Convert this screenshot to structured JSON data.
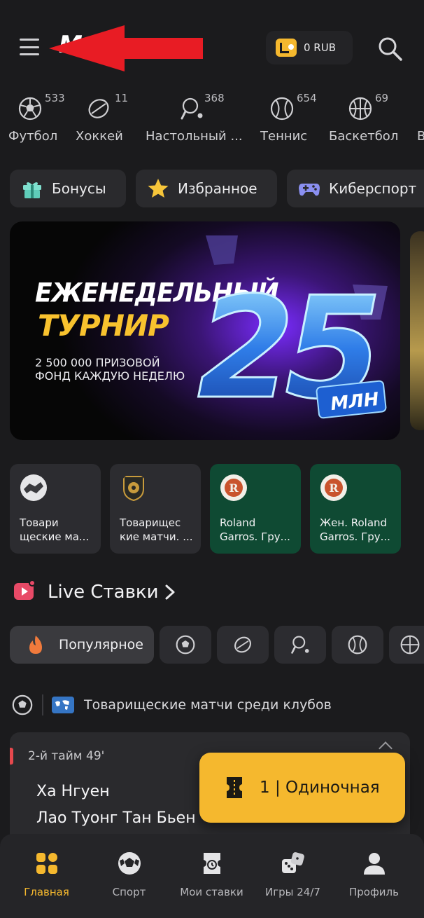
{
  "colors": {
    "background": "#1b1b1d",
    "surface": "#2a2a2d",
    "accent": "#f5b82e",
    "live": "#e5484d",
    "card_green": "#0f4a33"
  },
  "header": {
    "logo": "M",
    "balance": "0 RUB",
    "menu_icon": "hamburger-icon",
    "search_icon": "search-icon"
  },
  "sports": [
    {
      "label": "Футбол",
      "count": "533",
      "icon": "soccer-ball-icon"
    },
    {
      "label": "Хоккей",
      "count": "11",
      "icon": "hockey-puck-icon"
    },
    {
      "label": "Настольный ...",
      "count": "368",
      "icon": "table-tennis-icon"
    },
    {
      "label": "Теннис",
      "count": "654",
      "icon": "tennis-ball-icon"
    },
    {
      "label": "Баскетбол",
      "count": "69",
      "icon": "basketball-icon"
    },
    {
      "label": "В",
      "count": "",
      "icon": ""
    }
  ],
  "chips": [
    {
      "label": "Бонусы",
      "icon": "gift-icon"
    },
    {
      "label": "Избранное",
      "icon": "star-icon"
    },
    {
      "label": "Киберспорт",
      "icon": "gamepad-icon"
    }
  ],
  "banner": {
    "title_line1": "ЕЖЕНЕДЕЛЬНЫЙ",
    "title_line2": "ТУРНИР",
    "subtitle": "2 500 000 ПРИЗОВОЙ ФОНД КАЖДУЮ НЕДЕЛЮ",
    "big_number": "25",
    "unit": "МЛН"
  },
  "cards": [
    {
      "text": "Товари\nщеские ма...",
      "logo": "handshake-icon"
    },
    {
      "text": "Товарищес\nкие матчи. ...",
      "logo": "club-badge-icon"
    },
    {
      "text": "Roland\nGarros. Гру...",
      "logo": "roland-garros-logo"
    },
    {
      "text": "Жен. Roland\nGarros. Гру...",
      "logo": "roland-garros-logo"
    }
  ],
  "live": {
    "title": "Live Ставки",
    "filters": [
      {
        "label": "Популярное",
        "icon": "fire-icon"
      },
      {
        "label": "",
        "icon": "soccer-ball-icon"
      },
      {
        "label": "",
        "icon": "hockey-puck-icon"
      },
      {
        "label": "",
        "icon": "table-tennis-icon"
      },
      {
        "label": "",
        "icon": "tennis-ball-icon"
      },
      {
        "label": "",
        "icon": "basketball-icon"
      }
    ],
    "league": "Товарищеские матчи среди клубов",
    "match": {
      "time": "2-й тайм 49'",
      "team1": "Ха Нгуен",
      "team2": "Лао Туонг Тан Бьен"
    }
  },
  "betslip": {
    "label": "1 | Одиночная"
  },
  "nav": [
    {
      "label": "Главная",
      "icon": "home-grid-icon",
      "active": true
    },
    {
      "label": "Спорт",
      "icon": "soccer-ball-icon",
      "active": false
    },
    {
      "label": "Мои ставки",
      "icon": "ticket-clock-icon",
      "active": false
    },
    {
      "label": "Игры 24/7",
      "icon": "dice-icon",
      "active": false
    },
    {
      "label": "Профиль",
      "icon": "user-icon",
      "active": false
    }
  ]
}
